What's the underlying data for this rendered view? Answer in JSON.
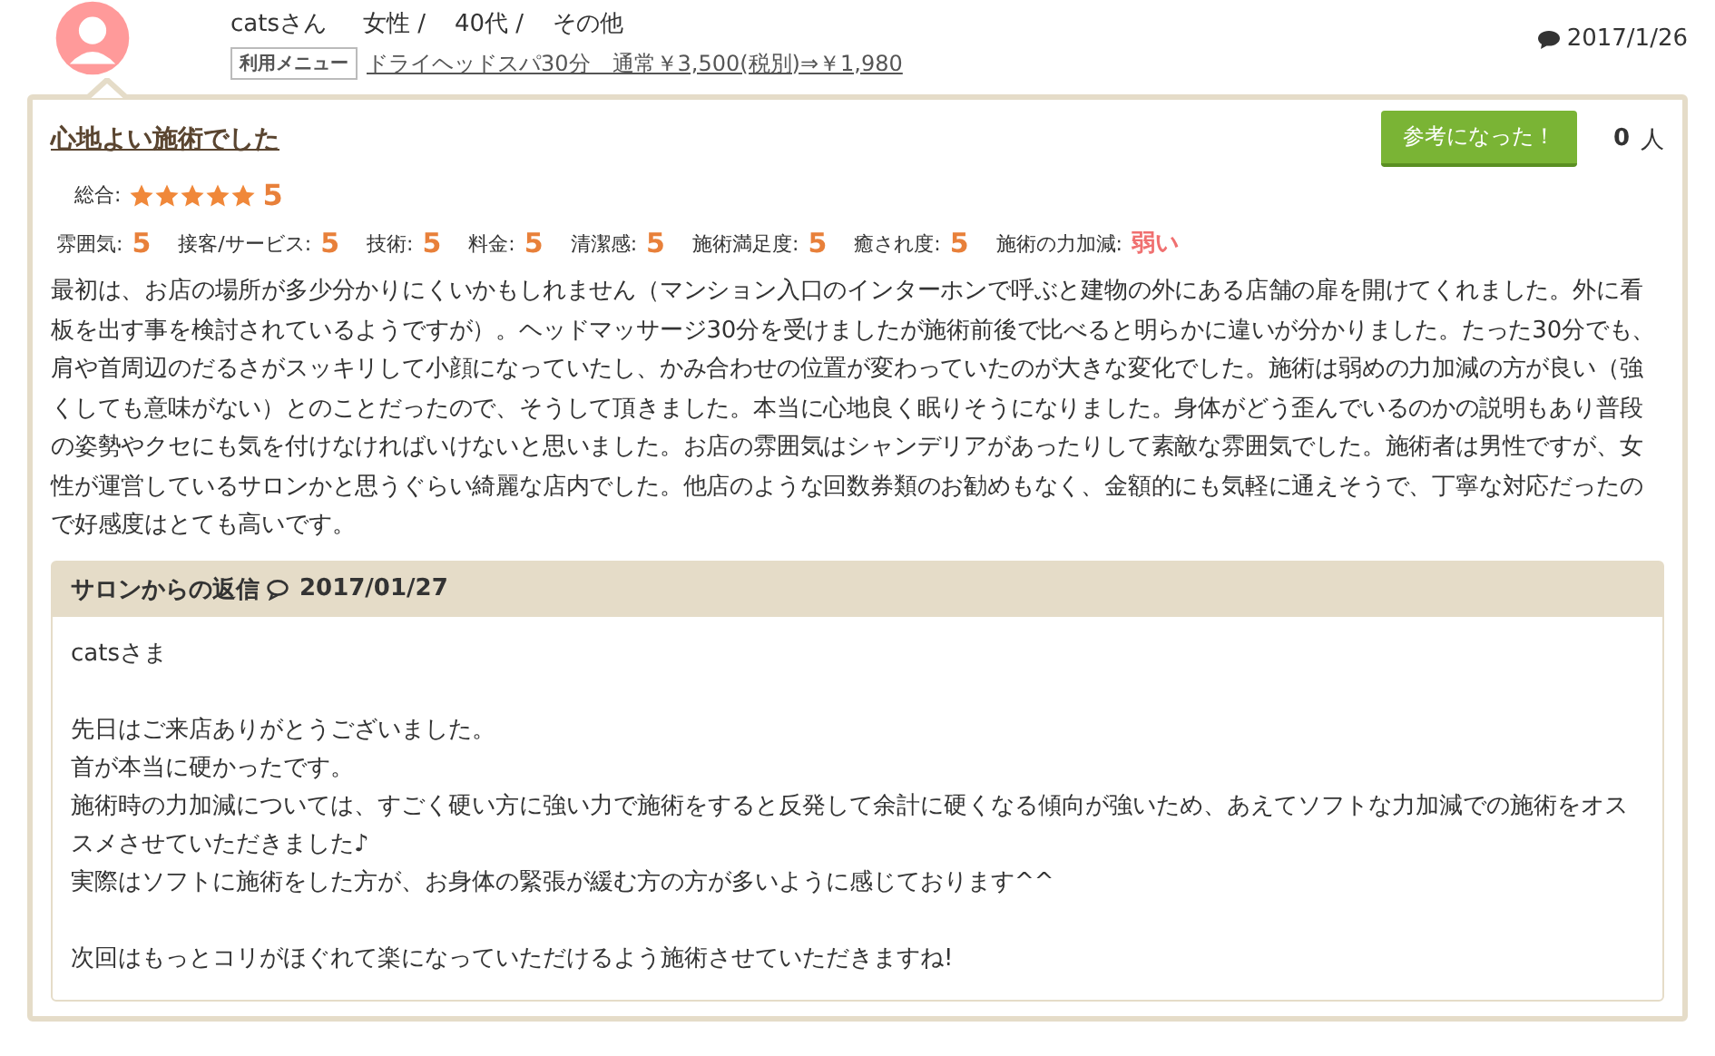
{
  "reviewer": {
    "name": "catsさん",
    "gender": "女性 /",
    "age": "40代 /",
    "other": "その他",
    "menu_label": "利用メニュー",
    "menu": "ドライヘッドスパ30分　通常￥3,500(税別)⇒￥1,980",
    "date": "2017/1/26"
  },
  "review": {
    "title": "心地よい施術でした",
    "helpful_button": "参考になった！",
    "helpful_count": "0",
    "helpful_unit": "人",
    "overall": {
      "label": "総合:",
      "stars": 5,
      "score": "5"
    },
    "ratings": [
      {
        "label": "雰囲気:",
        "value": "5",
        "kind": "score"
      },
      {
        "label": "接客/サービス:",
        "value": "5",
        "kind": "score"
      },
      {
        "label": "技術:",
        "value": "5",
        "kind": "score"
      },
      {
        "label": "料金:",
        "value": "5",
        "kind": "score"
      },
      {
        "label": "清潔感:",
        "value": "5",
        "kind": "score"
      },
      {
        "label": "施術満足度:",
        "value": "5",
        "kind": "score"
      },
      {
        "label": "癒され度:",
        "value": "5",
        "kind": "score"
      },
      {
        "label": "施術の力加減:",
        "value": "弱い",
        "kind": "word"
      }
    ],
    "body": "最初は、お店の場所が多少分かりにくいかもしれません（マンション入口のインターホンで呼ぶと建物の外にある店舗の扉を開けてくれました。外に看板を出す事を検討されているようですが）。ヘッドマッサージ30分を受けましたが施術前後で比べると明らかに違いが分かりました。たった30分でも、肩や首周辺のだるさがスッキリして小顔になっていたし、かみ合わせの位置が変わっていたのが大きな変化でした。施術は弱めの力加減の方が良い（強くしても意味がない）とのことだったので、そうして頂きました。本当に心地良く眠りそうになりました。身体がどう歪んでいるのかの説明もあり普段の姿勢やクセにも気を付けなければいけないと思いました。お店の雰囲気はシャンデリアがあったりして素敵な雰囲気でした。施術者は男性ですが、女性が運営しているサロンかと思うぐらい綺麗な店内でした。他店のような回数券類のお勧めもなく、金額的にも気軽に通えそうで、丁寧な対応だったので好感度はとても高いです。"
  },
  "reply": {
    "title": "サロンからの返信",
    "date": "2017/01/27",
    "paragraphs": [
      {
        "lines": [
          "catsさま"
        ]
      },
      {
        "lines": [
          "先日はご来店ありがとうございました。",
          "首が本当に硬かったです。",
          "施術時の力加減については、すごく硬い方に強い力で施術をすると反発して余計に硬くなる傾向が強いため、あえてソフトな力加減での施術をオススメさせていただきました♪",
          "実際はソフトに施術をした方が、お身体の緊張が緩む方の方が多いように感じております^^"
        ]
      },
      {
        "lines": [
          "次回はもっとコリがほぐれて楽になっていただけるよう施術させていただきますね!"
        ]
      }
    ]
  }
}
